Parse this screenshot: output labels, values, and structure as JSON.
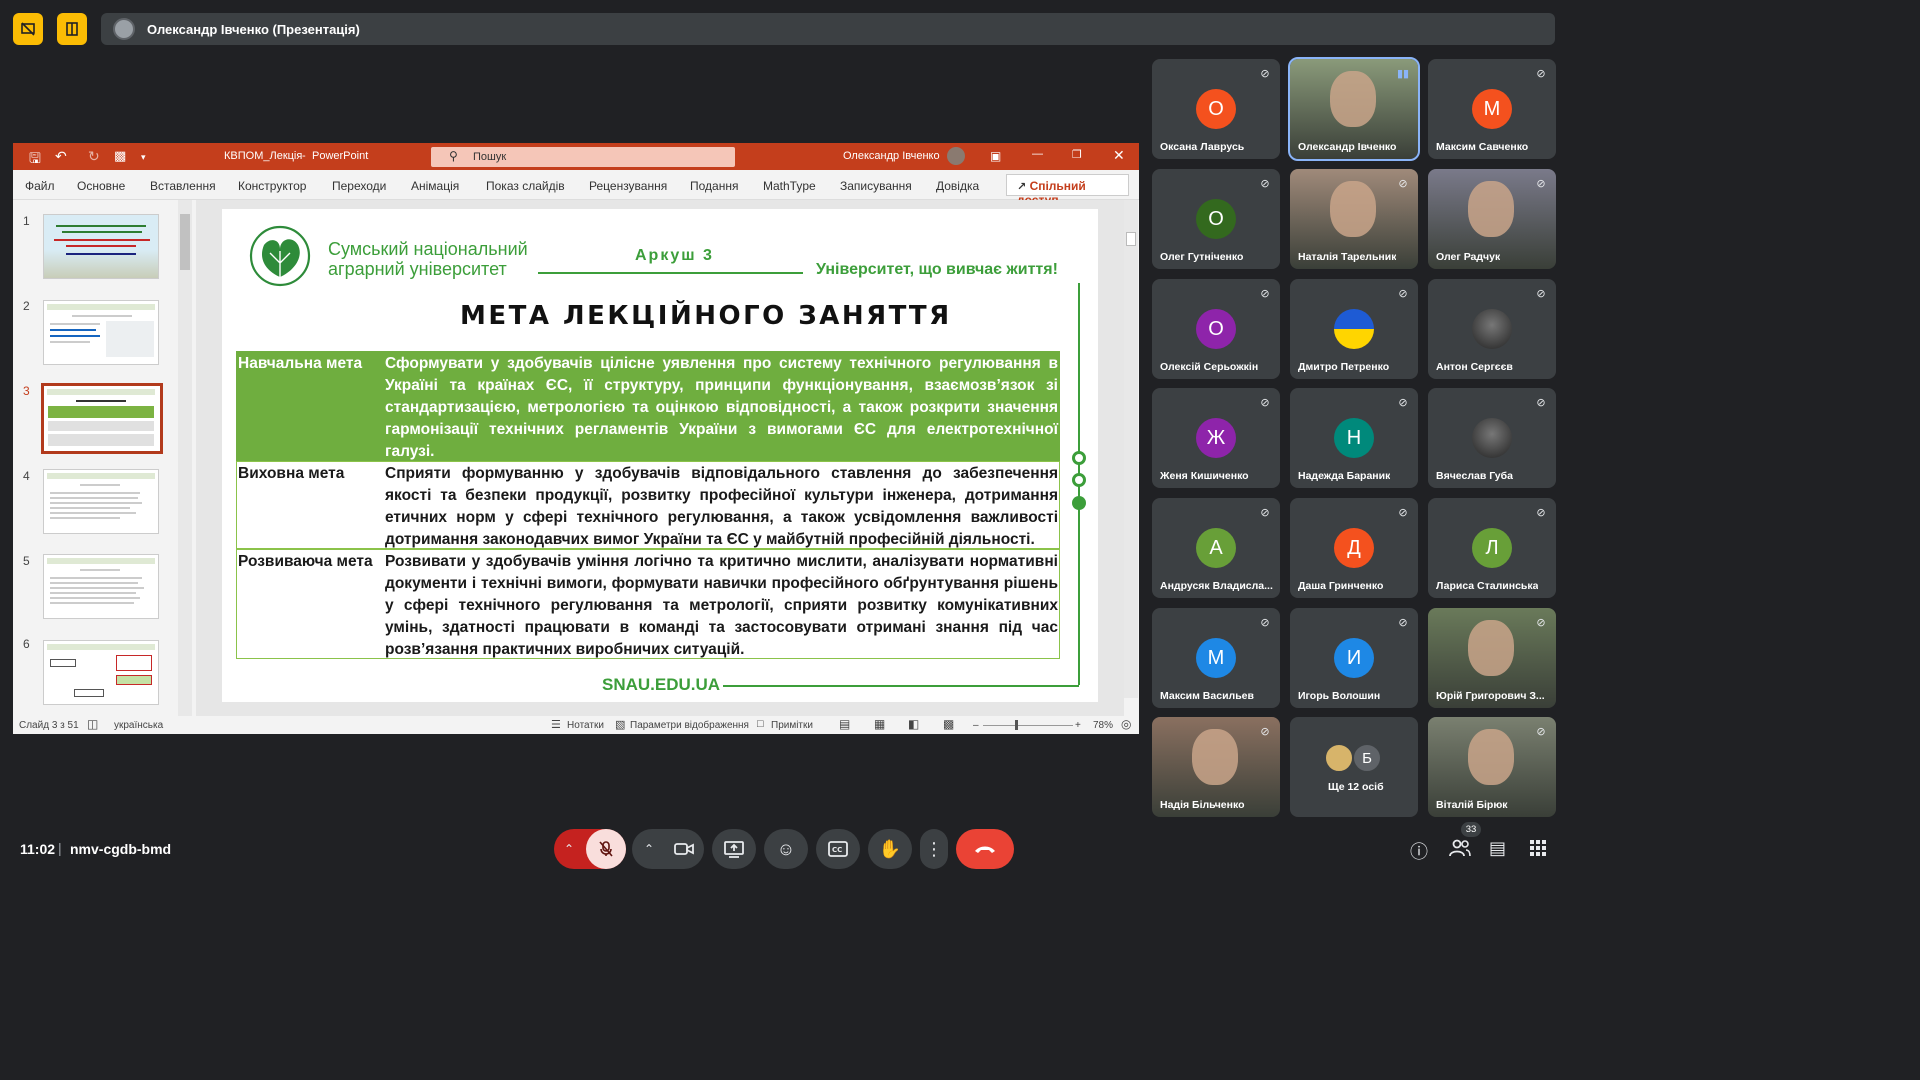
{
  "topbar": {
    "presenter_label": "Олександр Івченко (Презентація)"
  },
  "ppt": {
    "file_name": "КВПОМ_Лекція",
    "separator": "-",
    "app_name": "PowerPoint",
    "search_placeholder": "Пошук",
    "user_name": "Олександр Івченко",
    "menu": [
      "Файл",
      "Основне",
      "Вставлення",
      "Конструктор",
      "Переходи",
      "Анімація",
      "Показ слайдів",
      "Рецензування",
      "Подання",
      "MathType",
      "Записування",
      "Довідка"
    ],
    "share_label": "Спільний доступ",
    "thumb_numbers": [
      "1",
      "2",
      "3",
      "4",
      "5",
      "6"
    ],
    "status": {
      "slide_counter": "Слайд 3 з 51",
      "language": "українська",
      "notes": "Нотатки",
      "display_settings": "Параметри відображення",
      "comments": "Примітки",
      "zoom": "78%",
      "minus": "–",
      "plus": "+"
    }
  },
  "slide": {
    "university_line1": "Сумський національний",
    "university_line2": "аграрний університет",
    "sheet": "Аркуш 3",
    "motto": "Університет, що вивчає життя!",
    "title": "МЕТА ЛЕКЦІЙНОГО ЗАНЯТТЯ",
    "rows": [
      {
        "label": "Навчальна мета",
        "text": "Сформувати у здобувачів цілісне уявлення про систему технічного регулювання в Україні та країнах ЄС, її структуру, принципи функціонування, взаємозв’язок зі стандартизацією, метрологією та оцінкою відповідності, а також розкрити значення гармонізації технічних регламентів України з вимогами ЄС для електротехнічної галузі."
      },
      {
        "label": "Виховна мета",
        "text": "Сприяти формуванню у здобувачів відповідального ставлення до забезпечення якості та безпеки продукції, розвитку професійної культури інженера, дотримання етичних норм у сфері технічного регулювання, а також усвідомлення важливості дотримання законодавчих вимог України та ЄС у майбутній професійній діяльності."
      },
      {
        "label": "Розвиваюча мета",
        "text": "Розвивати у здобувачів уміння логічно та критично мислити, аналізувати нормативні документи і технічні вимоги, формувати навички професійного обґрунтування рішень у сфері технічного регулювання та метрології, сприяти розвитку комунікативних умінь, здатності працювати в команді та застосовувати отримані знання під час розв’язання практичних виробничих ситуацій."
      }
    ],
    "footer_url": "SNAU.EDU.UA"
  },
  "participants": [
    {
      "name": "Оксана Лаврусь",
      "initial": "О",
      "color": "#f4511e",
      "photo": false
    },
    {
      "name": "Олександр Івченко",
      "initial": "",
      "color": "#8a9a7a",
      "photo": true
    },
    {
      "name": "Максим Савченко",
      "initial": "М",
      "color": "#f4511e",
      "photo": false
    },
    {
      "name": "Олег Гутніченко",
      "initial": "О",
      "color": "#33691e",
      "photo": false
    },
    {
      "name": "Наталія Тарельник",
      "initial": "",
      "color": "#a08a7a",
      "photo": true
    },
    {
      "name": "Олег Радчук",
      "initial": "",
      "color": "#7a7a8a",
      "photo": true
    },
    {
      "name": "Олексій Серьожкін",
      "initial": "О",
      "color": "#8e24aa",
      "photo": false
    },
    {
      "name": "Дмитро Петренко",
      "initial": "",
      "color": "#3c4043",
      "photo": false,
      "flag": true
    },
    {
      "name": "Антон Сергєєв",
      "initial": "",
      "color": "#3c4043",
      "photo": false,
      "dark": true
    },
    {
      "name": "Женя Кишиченко",
      "initial": "Ж",
      "color": "#8e24aa",
      "photo": false
    },
    {
      "name": "Надежда Бараник",
      "initial": "Н",
      "color": "#00897b",
      "photo": false
    },
    {
      "name": "Вячеслав Губа",
      "initial": "",
      "color": "#3c4043",
      "photo": false,
      "dark": true
    },
    {
      "name": "Андрусяк Владисла...",
      "initial": "А",
      "color": "#689f38",
      "photo": false
    },
    {
      "name": "Даша Гринченко",
      "initial": "Д",
      "color": "#f4511e",
      "photo": false
    },
    {
      "name": "Лариса Сталинська",
      "initial": "Л",
      "color": "#689f38",
      "photo": false
    },
    {
      "name": "Максим Васильев",
      "initial": "М",
      "color": "#1e88e5",
      "photo": false
    },
    {
      "name": "Игорь Волошин",
      "initial": "И",
      "color": "#1e88e5",
      "photo": false
    },
    {
      "name": "Юрій Григорович З...",
      "initial": "",
      "color": "#6a7a5a",
      "photo": true
    },
    {
      "name": "Надія Більченко",
      "initial": "",
      "color": "#8a7060",
      "photo": true
    },
    {
      "name": "Ще 12 осіб",
      "initial": "Б",
      "color": "#5f6368",
      "photo": false,
      "more": true
    },
    {
      "name": "Віталій Бірюк",
      "initial": "",
      "color": "#7a8070",
      "photo": true
    }
  ],
  "bottombar": {
    "time": "11:02",
    "separator": "|",
    "meeting_code": "nmv-cgdb-bmd",
    "participants_count": "33"
  }
}
